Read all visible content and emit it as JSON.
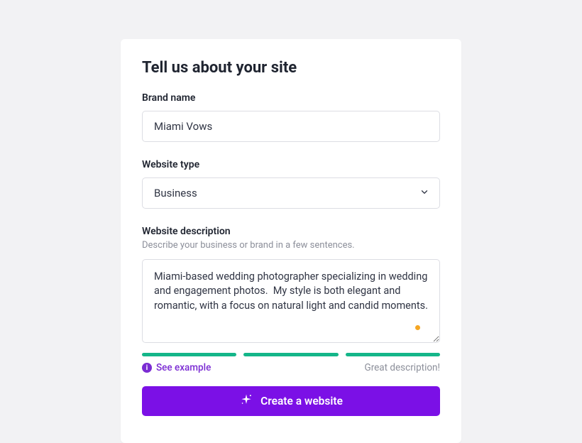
{
  "title": "Tell us about your site",
  "brand": {
    "label": "Brand name",
    "value": "Miami Vows"
  },
  "type": {
    "label": "Website type",
    "value": "Business"
  },
  "description": {
    "label": "Website description",
    "hint": "Describe your business or brand in a few sentences.",
    "value": "Miami-based wedding photographer specializing in wedding and engagement photos.  My style is both elegant and romantic, with a focus on natural light and candid moments."
  },
  "example_link": "See example",
  "feedback": "Great description!",
  "cta": "Create a website"
}
